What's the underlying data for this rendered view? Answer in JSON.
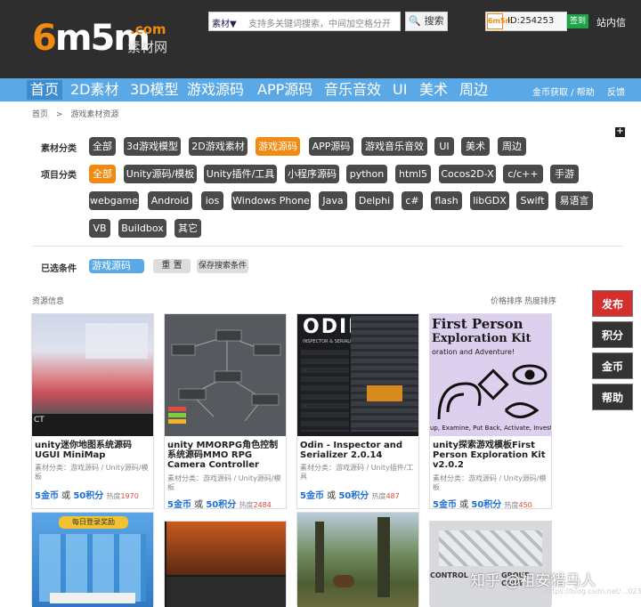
{
  "header": {
    "logo_text": "6m5m",
    "logo_com": ".com",
    "logo_cn": "素材网",
    "search_category": "素材▼",
    "search_placeholder": "支持多关键词搜索，中间加空格分开",
    "search_button": "搜索",
    "avatar_text": "6m5m",
    "user_id": "ID:254253",
    "sign_button": "签到",
    "message_link": "站内信"
  },
  "nav": {
    "items": [
      "首页",
      "2D素材",
      "3D模型",
      "游戏源码",
      "APP源码",
      "音乐音效",
      "UI",
      "美术",
      "周边"
    ],
    "right": [
      "金币获取 / 帮助",
      "反馈"
    ]
  },
  "breadcrumb": {
    "home": "首页",
    "sep": ">",
    "current": "游戏素材资源"
  },
  "filters": {
    "category_label": "素材分类",
    "categories": [
      "全部",
      "3d游戏模型",
      "2D游戏素材",
      "游戏源码",
      "APP源码",
      "游戏音乐音效",
      "UI",
      "美术",
      "周边"
    ],
    "category_selected": "游戏源码",
    "project_label": "项目分类",
    "projects": [
      "全部",
      "Unity源码/模板",
      "Unity插件/工具",
      "小程序源码",
      "python",
      "html5",
      "Cocos2D-X",
      "c/c++",
      "手游",
      "webgame",
      "Android",
      "ios",
      "Windows Phone",
      "Java",
      "Delphi",
      "c#",
      "flash",
      "libGDX",
      "Swift",
      "易语言",
      "VB",
      "Buildbox",
      "其它"
    ],
    "project_selected": "全部"
  },
  "selected": {
    "label": "已选条件",
    "chip": "游戏源码",
    "chip_close": "×",
    "reset": "重 置",
    "save": "保存搜索条件"
  },
  "results": {
    "title": "资源信息",
    "sort_price": "价格排序",
    "sort_heat": "热度排序",
    "cards": [
      {
        "title": "unity迷你地图系统源码UGUI MiniMap",
        "meta": "素材分类：游戏源码 / Unity源码/模板",
        "gold": "5金币",
        "or": "或",
        "points": "50积分",
        "heat_label": "热度",
        "heat": "1970"
      },
      {
        "title": "unity MMORPG角色控制系统源码MMO RPG Camera Controller",
        "meta": "素材分类：游戏源码 / Unity源码/模板",
        "gold": "5金币",
        "or": "或",
        "points": "50积分",
        "heat_label": "热度",
        "heat": "2484"
      },
      {
        "title": "Odin - Inspector and Serializer 2.0.14",
        "meta": "素材分类：游戏源码 / Unity插件/工具",
        "gold": "5金币",
        "or": "或",
        "points": "50积分",
        "heat_label": "热度",
        "heat": "487"
      },
      {
        "title": "unity探索游戏模板First Person Exploration Kit v2.0.2",
        "meta": "素材分类：游戏源码 / Unity源码/模板",
        "gold": "5金币",
        "or": "或",
        "points": "50积分",
        "heat_label": "热度",
        "heat": "450"
      }
    ],
    "thumb_texts": {
      "odin": "ODIN",
      "odin_sub": "INSPECTOR & SERIALIZER",
      "fpe1": "First Person",
      "fpe2": "Exploration Kit",
      "fpe3": "oration and Adventure!",
      "fpe4": "up, Examine, Put Back, Activate, Investig",
      "reward": "每日登录奖励",
      "control1": "CONTROL",
      "control2": "GROUP CONT"
    }
  },
  "sidebar": [
    "发布",
    "积分",
    "金币",
    "帮助"
  ],
  "watermark": {
    "main": "知乎 @祖安猎马人",
    "sub": "https://blog.csdn.net/...0232497"
  },
  "colors": {
    "accent": "#f08a12",
    "nav": "#5aa9e6",
    "dark": "#2e2e2e",
    "publish": "#d32f2f"
  }
}
